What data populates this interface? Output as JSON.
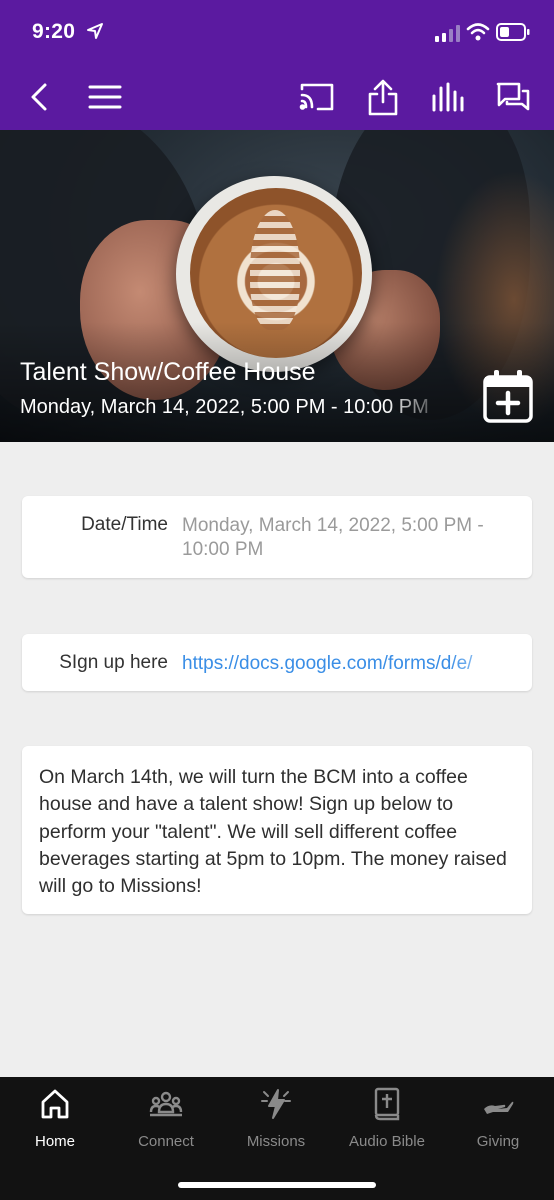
{
  "status_bar": {
    "time": "9:20",
    "icons": [
      "location-arrow-icon",
      "cellular-signal-icon",
      "wifi-icon",
      "battery-icon"
    ]
  },
  "nav_bar": {
    "icons": [
      "back-chevron-icon",
      "menu-icon",
      "cast-icon",
      "share-icon",
      "audio-levels-icon",
      "chat-icon"
    ],
    "color": "#5b1aa0"
  },
  "event": {
    "title": "Talent Show/Coffee House",
    "subtitle": "Monday, March 14, 2022, 5:00 PM - 10:00 PM",
    "add_to_calendar_icon": "calendar-plus-icon"
  },
  "details": {
    "date_label": "Date/Time",
    "date_value": "Monday, March 14, 2022, 5:00 PM - 10:00 PM",
    "signup_label": "SIgn up here",
    "signup_link": "https://docs.google.com/forms/d/e/",
    "description": "On March 14th, we will turn the BCM into a coffee house and have a talent show! Sign up below to perform your \"talent\". We will sell different coffee beverages starting at 5pm to 10pm. The money raised will go to Missions!"
  },
  "tabs": [
    {
      "label": "Home",
      "icon": "home-icon",
      "active": true
    },
    {
      "label": "Connect",
      "icon": "group-icon",
      "active": false
    },
    {
      "label": "Missions",
      "icon": "missions-icon",
      "active": false
    },
    {
      "label": "Audio Bible",
      "icon": "bible-icon",
      "active": false
    },
    {
      "label": "Giving",
      "icon": "giving-hand-icon",
      "active": false
    }
  ],
  "colors": {
    "accent": "#5b1aa0",
    "link": "#3a8ee6",
    "background": "#eeeeee",
    "tabbar": "#121212"
  }
}
